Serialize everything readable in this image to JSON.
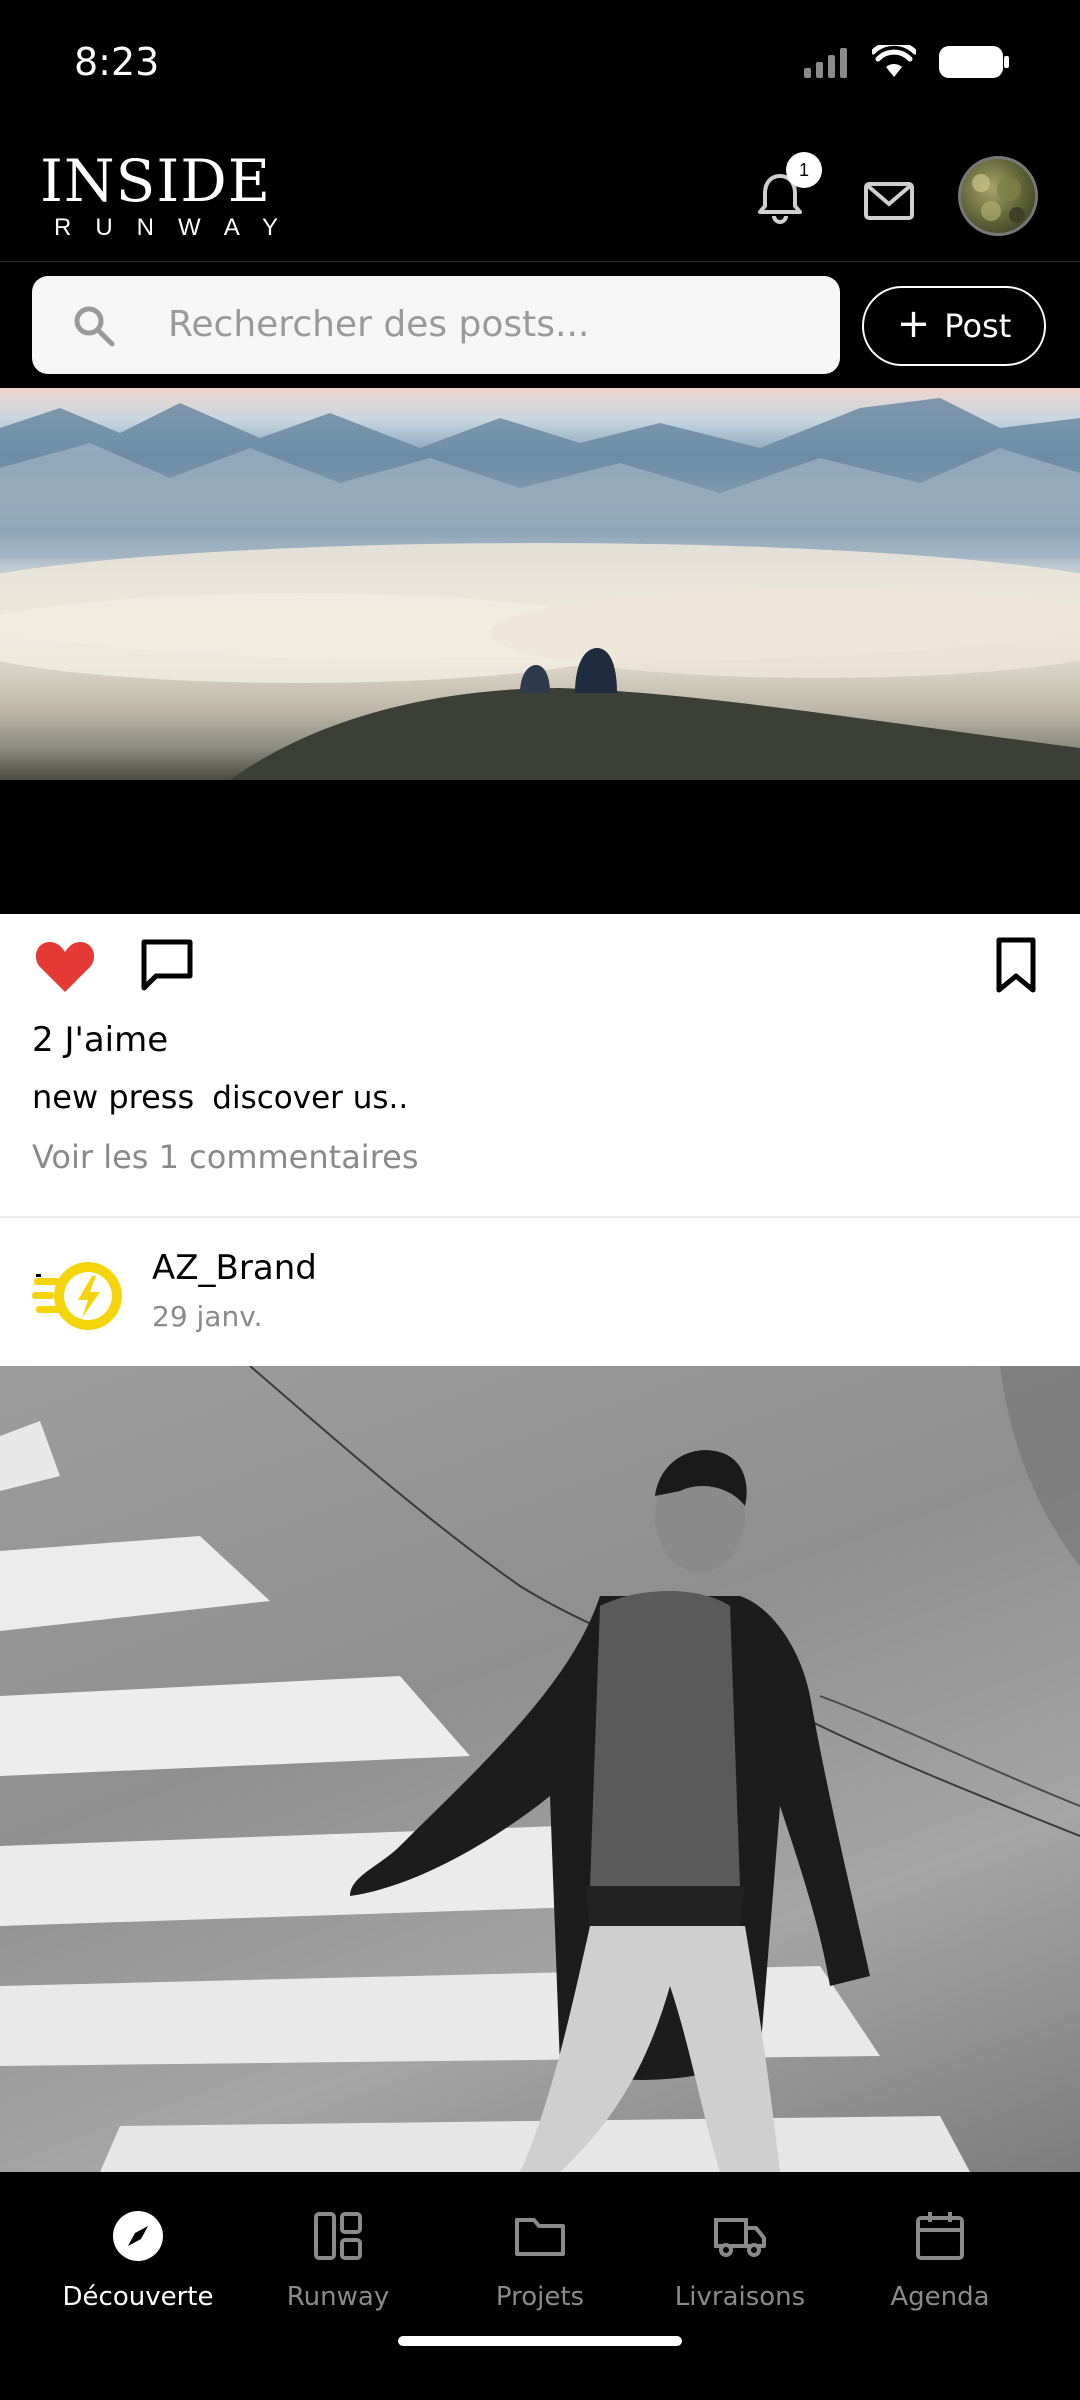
{
  "status_bar": {
    "time": "8:23",
    "icons": [
      "signal-icon",
      "wifi-icon",
      "battery-icon"
    ]
  },
  "header": {
    "logo_top": "INSIDE",
    "logo_bottom": "RUNWAY",
    "notification_count": "1",
    "icons": [
      "bell-icon",
      "mail-icon",
      "avatar"
    ]
  },
  "search": {
    "placeholder": "Rechercher des posts..."
  },
  "post_button": {
    "label": "Post"
  },
  "post1": {
    "likes": "2 J'aime",
    "author": "new press",
    "caption": "discover us..",
    "comments_link": "Voir les 1 commentaires",
    "liked": true
  },
  "post2": {
    "username": "AZ_Brand",
    "date": "29 janv."
  },
  "nav": {
    "items": [
      {
        "label": "Découverte",
        "icon": "compass-icon",
        "active": true
      },
      {
        "label": "Runway",
        "icon": "dashboard-icon",
        "active": false
      },
      {
        "label": "Projets",
        "icon": "folder-icon",
        "active": false
      },
      {
        "label": "Livraisons",
        "icon": "truck-icon",
        "active": false
      },
      {
        "label": "Agenda",
        "icon": "calendar-icon",
        "active": false
      }
    ]
  },
  "colors": {
    "background": "#000000",
    "feed_bg": "#ffffff",
    "heart": "#e53935",
    "brand_logo": "#f5d40c"
  }
}
